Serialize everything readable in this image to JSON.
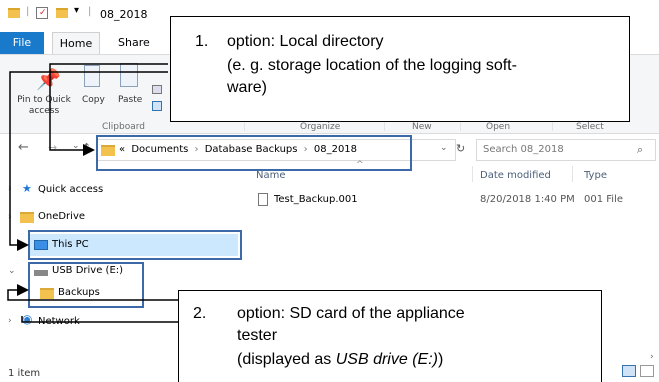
{
  "window": {
    "title": "08_2018"
  },
  "ribbon": {
    "tabs": {
      "file": "File",
      "home": "Home",
      "share": "Share"
    },
    "buttons": {
      "pin_to_quick_access": "Pin to Quick access",
      "copy": "Copy",
      "paste": "Paste"
    },
    "groups": {
      "clipboard": "Clipboard",
      "organize": "Organize",
      "new": "New",
      "open": "Open",
      "select": "Select"
    }
  },
  "address_bar": {
    "overflow": "«",
    "crumbs": [
      "Documents",
      "Database Backups",
      "08_2018"
    ],
    "separator": "›"
  },
  "search": {
    "placeholder": "Search 08_2018"
  },
  "nav": {
    "quick_access": "Quick access",
    "onedrive": "OneDrive",
    "this_pc": "This PC",
    "usb_drive": "USB Drive (E:)",
    "backups": "Backups",
    "network": "Network"
  },
  "file_list": {
    "columns": {
      "name": "Name",
      "date_modified": "Date modified",
      "type": "Type"
    },
    "rows": [
      {
        "name": "Test_Backup.001",
        "date_modified": "8/20/2018 1:40 PM",
        "type": "001 File"
      }
    ]
  },
  "status_bar": {
    "item_count": "1 item"
  },
  "callouts": {
    "c1": {
      "number": "1.",
      "line1": "option: Local directory",
      "line2": "(e. g. storage location of the logging soft-",
      "line3": "ware)"
    },
    "c2": {
      "number": "2.",
      "line1": "option: SD card of the appliance",
      "line2": "tester",
      "line3_prefix": "(displayed as ",
      "line3_italic": "USB drive (E:)",
      "line3_suffix": ")"
    }
  },
  "colors": {
    "accent": "#1979ca",
    "highlight_border": "#3c6aa8",
    "selection": "#cce8ff"
  }
}
